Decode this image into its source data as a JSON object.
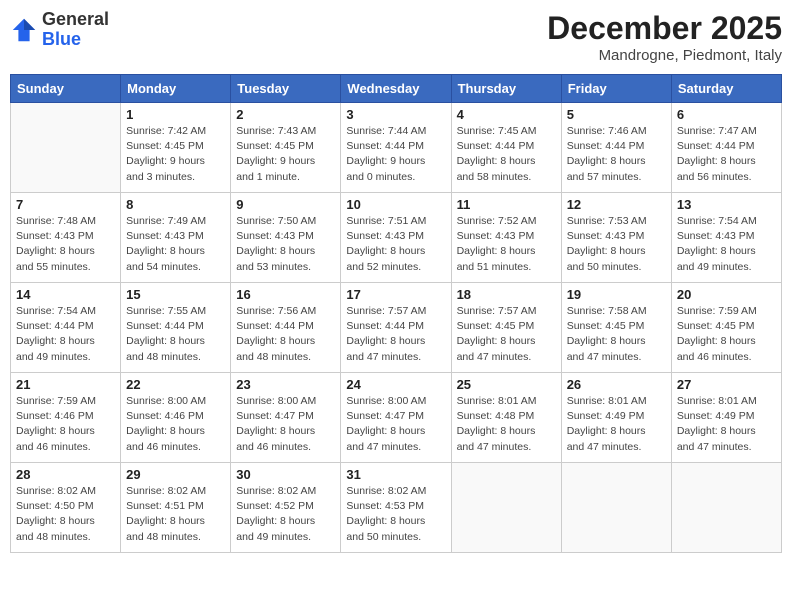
{
  "header": {
    "logo_general": "General",
    "logo_blue": "Blue",
    "month_title": "December 2025",
    "subtitle": "Mandrogne, Piedmont, Italy"
  },
  "calendar": {
    "days_of_week": [
      "Sunday",
      "Monday",
      "Tuesday",
      "Wednesday",
      "Thursday",
      "Friday",
      "Saturday"
    ],
    "weeks": [
      [
        {
          "day": "",
          "info": ""
        },
        {
          "day": "1",
          "info": "Sunrise: 7:42 AM\nSunset: 4:45 PM\nDaylight: 9 hours\nand 3 minutes."
        },
        {
          "day": "2",
          "info": "Sunrise: 7:43 AM\nSunset: 4:45 PM\nDaylight: 9 hours\nand 1 minute."
        },
        {
          "day": "3",
          "info": "Sunrise: 7:44 AM\nSunset: 4:44 PM\nDaylight: 9 hours\nand 0 minutes."
        },
        {
          "day": "4",
          "info": "Sunrise: 7:45 AM\nSunset: 4:44 PM\nDaylight: 8 hours\nand 58 minutes."
        },
        {
          "day": "5",
          "info": "Sunrise: 7:46 AM\nSunset: 4:44 PM\nDaylight: 8 hours\nand 57 minutes."
        },
        {
          "day": "6",
          "info": "Sunrise: 7:47 AM\nSunset: 4:44 PM\nDaylight: 8 hours\nand 56 minutes."
        }
      ],
      [
        {
          "day": "7",
          "info": "Sunrise: 7:48 AM\nSunset: 4:43 PM\nDaylight: 8 hours\nand 55 minutes."
        },
        {
          "day": "8",
          "info": "Sunrise: 7:49 AM\nSunset: 4:43 PM\nDaylight: 8 hours\nand 54 minutes."
        },
        {
          "day": "9",
          "info": "Sunrise: 7:50 AM\nSunset: 4:43 PM\nDaylight: 8 hours\nand 53 minutes."
        },
        {
          "day": "10",
          "info": "Sunrise: 7:51 AM\nSunset: 4:43 PM\nDaylight: 8 hours\nand 52 minutes."
        },
        {
          "day": "11",
          "info": "Sunrise: 7:52 AM\nSunset: 4:43 PM\nDaylight: 8 hours\nand 51 minutes."
        },
        {
          "day": "12",
          "info": "Sunrise: 7:53 AM\nSunset: 4:43 PM\nDaylight: 8 hours\nand 50 minutes."
        },
        {
          "day": "13",
          "info": "Sunrise: 7:54 AM\nSunset: 4:43 PM\nDaylight: 8 hours\nand 49 minutes."
        }
      ],
      [
        {
          "day": "14",
          "info": "Sunrise: 7:54 AM\nSunset: 4:44 PM\nDaylight: 8 hours\nand 49 minutes."
        },
        {
          "day": "15",
          "info": "Sunrise: 7:55 AM\nSunset: 4:44 PM\nDaylight: 8 hours\nand 48 minutes."
        },
        {
          "day": "16",
          "info": "Sunrise: 7:56 AM\nSunset: 4:44 PM\nDaylight: 8 hours\nand 48 minutes."
        },
        {
          "day": "17",
          "info": "Sunrise: 7:57 AM\nSunset: 4:44 PM\nDaylight: 8 hours\nand 47 minutes."
        },
        {
          "day": "18",
          "info": "Sunrise: 7:57 AM\nSunset: 4:45 PM\nDaylight: 8 hours\nand 47 minutes."
        },
        {
          "day": "19",
          "info": "Sunrise: 7:58 AM\nSunset: 4:45 PM\nDaylight: 8 hours\nand 47 minutes."
        },
        {
          "day": "20",
          "info": "Sunrise: 7:59 AM\nSunset: 4:45 PM\nDaylight: 8 hours\nand 46 minutes."
        }
      ],
      [
        {
          "day": "21",
          "info": "Sunrise: 7:59 AM\nSunset: 4:46 PM\nDaylight: 8 hours\nand 46 minutes."
        },
        {
          "day": "22",
          "info": "Sunrise: 8:00 AM\nSunset: 4:46 PM\nDaylight: 8 hours\nand 46 minutes."
        },
        {
          "day": "23",
          "info": "Sunrise: 8:00 AM\nSunset: 4:47 PM\nDaylight: 8 hours\nand 46 minutes."
        },
        {
          "day": "24",
          "info": "Sunrise: 8:00 AM\nSunset: 4:47 PM\nDaylight: 8 hours\nand 47 minutes."
        },
        {
          "day": "25",
          "info": "Sunrise: 8:01 AM\nSunset: 4:48 PM\nDaylight: 8 hours\nand 47 minutes."
        },
        {
          "day": "26",
          "info": "Sunrise: 8:01 AM\nSunset: 4:49 PM\nDaylight: 8 hours\nand 47 minutes."
        },
        {
          "day": "27",
          "info": "Sunrise: 8:01 AM\nSunset: 4:49 PM\nDaylight: 8 hours\nand 47 minutes."
        }
      ],
      [
        {
          "day": "28",
          "info": "Sunrise: 8:02 AM\nSunset: 4:50 PM\nDaylight: 8 hours\nand 48 minutes."
        },
        {
          "day": "29",
          "info": "Sunrise: 8:02 AM\nSunset: 4:51 PM\nDaylight: 8 hours\nand 48 minutes."
        },
        {
          "day": "30",
          "info": "Sunrise: 8:02 AM\nSunset: 4:52 PM\nDaylight: 8 hours\nand 49 minutes."
        },
        {
          "day": "31",
          "info": "Sunrise: 8:02 AM\nSunset: 4:53 PM\nDaylight: 8 hours\nand 50 minutes."
        },
        {
          "day": "",
          "info": ""
        },
        {
          "day": "",
          "info": ""
        },
        {
          "day": "",
          "info": ""
        }
      ]
    ]
  }
}
